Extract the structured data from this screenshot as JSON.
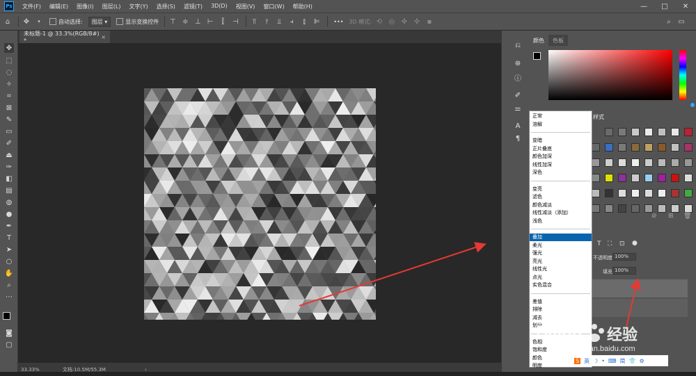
{
  "app": {
    "logo": "Ps",
    "menu": [
      "文件(F)",
      "编辑(E)",
      "图像(I)",
      "图层(L)",
      "文字(Y)",
      "选择(S)",
      "滤镜(T)",
      "3D(D)",
      "视图(V)",
      "窗口(W)",
      "帮助(H)"
    ],
    "window_buttons": [
      "—",
      "□",
      "✕"
    ]
  },
  "options": {
    "auto_select_label": "自动选择:",
    "auto_select_value": "图层",
    "show_transform_label": "显示变换控件",
    "mode_3d_label": "3D 模式:",
    "more": "•••"
  },
  "document": {
    "tab_title": "未标题-1 @ 33.3%(RGB/8#) *",
    "close": "×",
    "zoom": "33.33%",
    "doc_info": "文档:10.5M/55.3M",
    "arrow": "›"
  },
  "color_panel": {
    "tabs": [
      "颜色",
      "色板"
    ]
  },
  "styles_panel": {
    "tab_partial": "样式"
  },
  "layers_panel": {
    "opacity_label": "不透明度:",
    "opacity_value": "100%",
    "fill_label": "填充:",
    "fill_value": "100%"
  },
  "blend_menu": {
    "groups": [
      [
        "正常",
        "溶解"
      ],
      [
        "变暗",
        "正片叠底",
        "颜色加深",
        "线性加深",
        "深色"
      ],
      [
        "变亮",
        "滤色",
        "颜色减淡",
        "线性减淡（添加）",
        "浅色"
      ],
      [
        "叠加",
        "柔光",
        "强光",
        "亮光",
        "线性光",
        "点光",
        "实色混合"
      ],
      [
        "差值",
        "排除",
        "减去",
        "划分"
      ],
      [
        "色相",
        "饱和度",
        "颜色",
        "明度"
      ]
    ],
    "selected": "叠加"
  },
  "watermark": {
    "brand": "Baidu",
    "suffix": "经验",
    "url": "jingyan.baidu.com"
  },
  "ime_bar": {
    "items": [
      "S",
      "英",
      "☽",
      "•",
      "⌨",
      "简",
      "👕",
      "⚙"
    ]
  },
  "colors": {
    "accent_arrow": "#e53935",
    "selection": "#0a64ad",
    "panel_bg": "#535353",
    "canvas_bg": "#282828"
  }
}
